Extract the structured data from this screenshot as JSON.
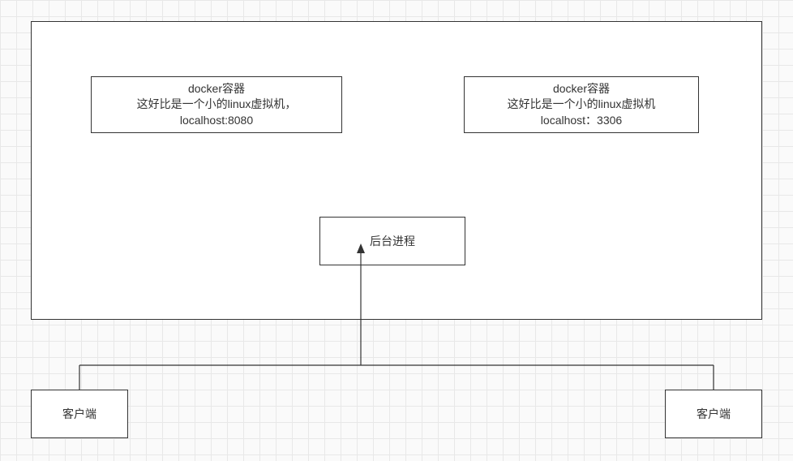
{
  "container1": {
    "line1": "docker容器",
    "line2": "这好比是一个小的linux虚拟机，",
    "line3": "localhost:8080"
  },
  "container2": {
    "line1": "docker容器",
    "line2": "这好比是一个小的linux虚拟机",
    "line3": "localhost：3306"
  },
  "backend_process": "后台进程",
  "client1": "客户端",
  "client2": "客户端"
}
